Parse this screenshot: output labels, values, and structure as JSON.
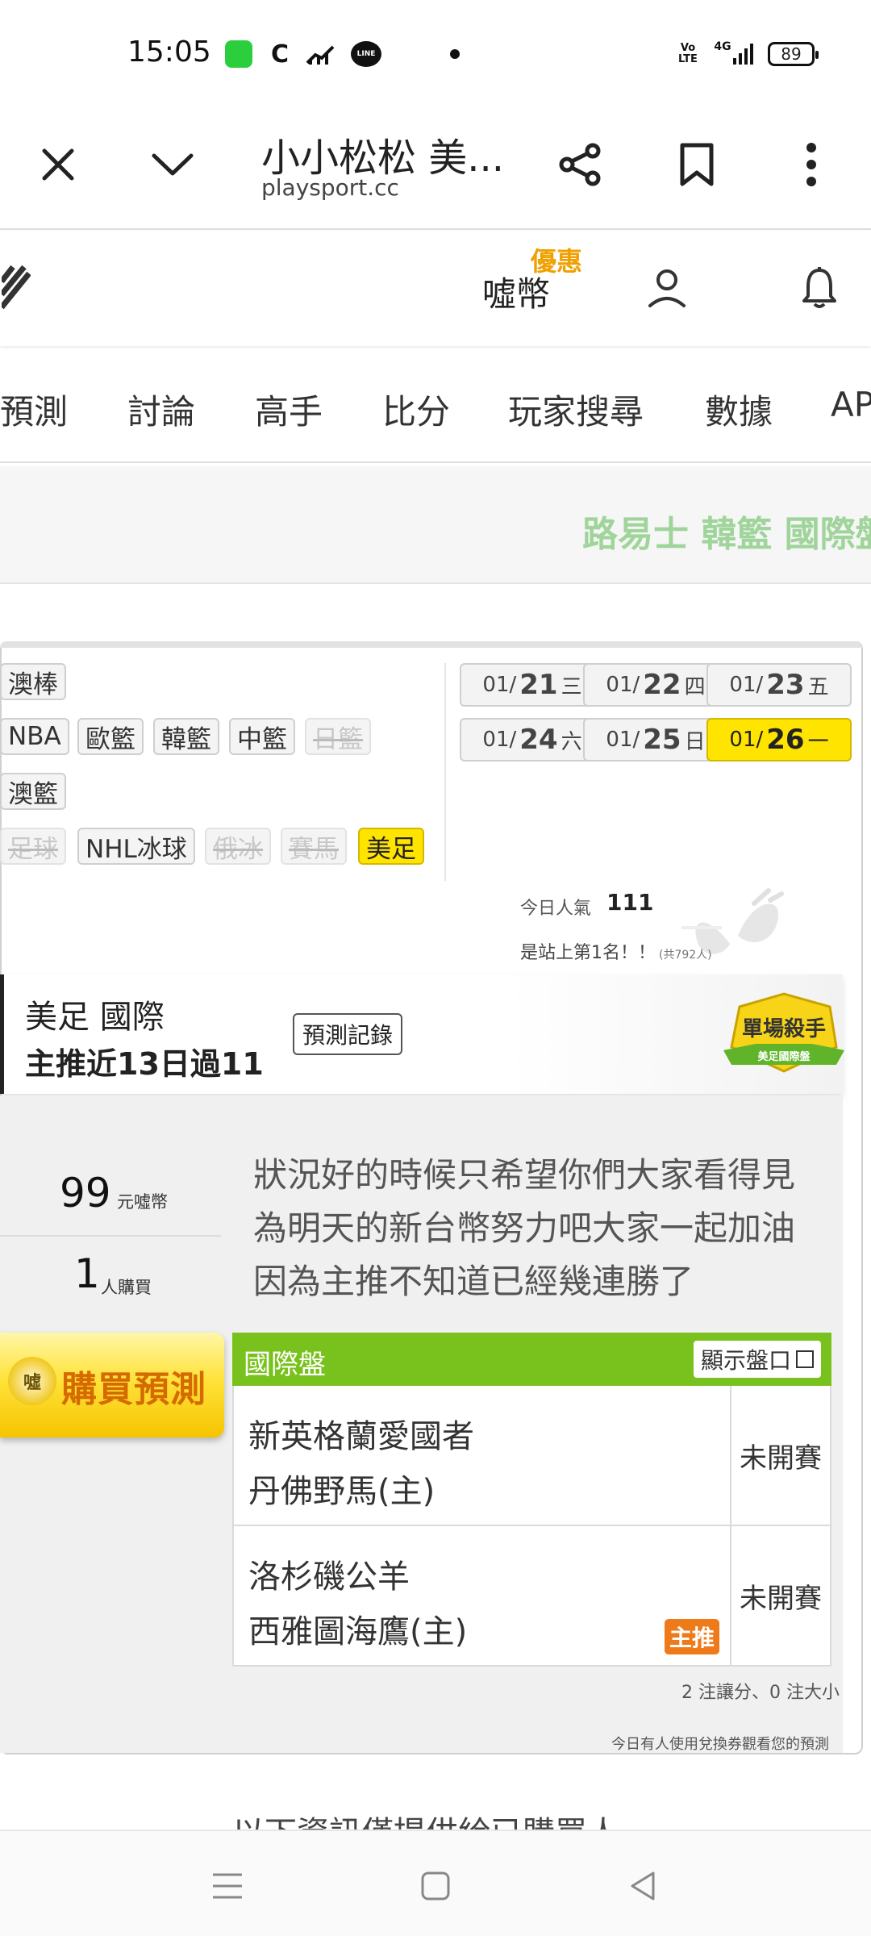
{
  "status_bar": {
    "time": "15:05",
    "battery": "89",
    "icons": [
      "app-green-icon",
      "c-icon",
      "signal-chart-icon",
      "line-icon",
      "dot-icon",
      "volte-icon",
      "4g-signal-icon",
      "battery-icon"
    ],
    "letter_c": "C",
    "line_text": "LINE",
    "volte": "Vo LTE",
    "network": "4G"
  },
  "browser": {
    "title": "小小松松 美...",
    "url": "playsport.cc",
    "icons": [
      "close-icon",
      "chevron-down-icon",
      "share-icon",
      "bookmark-icon",
      "more-icon"
    ]
  },
  "site_header": {
    "coin_label": "噓幣",
    "promo_label": "優惠",
    "icons": [
      "logo-icon",
      "user-icon",
      "bell-icon"
    ]
  },
  "nav": {
    "items": [
      "預測",
      "討論",
      "高手",
      "比分",
      "玩家搜尋",
      "數據",
      "AP"
    ]
  },
  "marquee": {
    "text": "路易士 韓籃 國際盤"
  },
  "sport_filters": [
    {
      "label": "澳棒",
      "state": "normal"
    },
    {
      "label": "NBA",
      "state": "normal"
    },
    {
      "label": "歐籃",
      "state": "normal"
    },
    {
      "label": "韓籃",
      "state": "normal"
    },
    {
      "label": "中籃",
      "state": "normal"
    },
    {
      "label": "日籃",
      "state": "disabled"
    },
    {
      "label": "澳籃",
      "state": "normal"
    },
    {
      "label": "足球",
      "state": "disabled"
    },
    {
      "label": "NHL冰球",
      "state": "normal"
    },
    {
      "label": "俄冰",
      "state": "disabled"
    },
    {
      "label": "賽馬",
      "state": "disabled"
    },
    {
      "label": "美足",
      "state": "active"
    }
  ],
  "dates": [
    {
      "month": "01/",
      "day": "21",
      "weekday": "三",
      "active": false
    },
    {
      "month": "01/",
      "day": "22",
      "weekday": "四",
      "active": false
    },
    {
      "month": "01/",
      "day": "23",
      "weekday": "五",
      "active": false
    },
    {
      "month": "01/",
      "day": "24",
      "weekday": "六",
      "active": false
    },
    {
      "month": "01/",
      "day": "25",
      "weekday": "日",
      "active": false
    },
    {
      "month": "01/",
      "day": "26",
      "weekday": "一",
      "active": true
    }
  ],
  "popularity": {
    "label": "今日人氣",
    "count": "111",
    "rank_text": "是站上第1名！！",
    "rank_sub": "(共792人)"
  },
  "banner": {
    "league": "美足 國際",
    "record": "主推近13日過11",
    "record_button": "預測記錄",
    "badge_title": "單場殺手",
    "badge_sub": "美足國際盤"
  },
  "purchase": {
    "price": "99",
    "price_unit": "元噓幣",
    "buyers": "1",
    "buyers_unit": "人購買",
    "buy_button": "購買預測",
    "buy_icon_text": "噓"
  },
  "comment": "狀況好的時候只希望你們大家看得見為明天的新台幣努力吧大家一起加油因為主推不知道已經幾連勝了",
  "odds": {
    "title": "國際盤",
    "show_button": "顯示盤口",
    "games": [
      {
        "away": "新英格蘭愛國者",
        "home": "丹佛野馬(主)",
        "status": "未開賽",
        "tag": ""
      },
      {
        "away": "洛杉磯公羊",
        "home": "西雅圖海鷹(主)",
        "status": "未開賽",
        "tag": "主推"
      }
    ],
    "summary": "2 注讓分、0 注大小",
    "footer_note": "今日有人使用兌換券觀看您的預測"
  },
  "cut_text": "以下資訊僅提供給已購買人",
  "system_nav": [
    "menu-icon",
    "home-icon",
    "back-icon"
  ]
}
